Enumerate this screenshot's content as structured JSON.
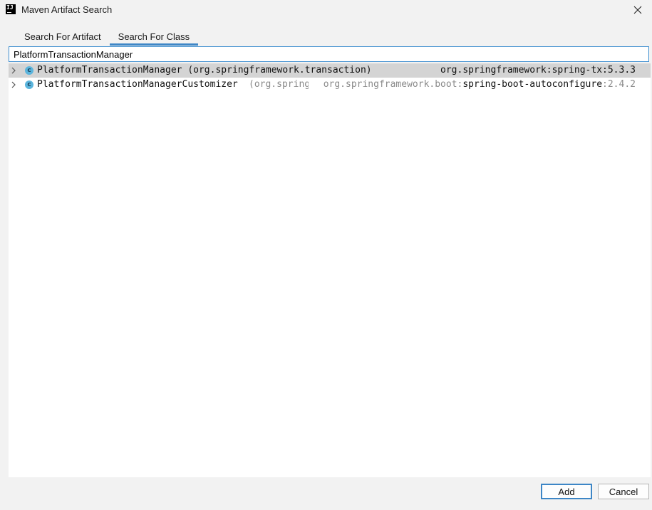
{
  "window": {
    "title": "Maven Artifact Search",
    "app_icon_text": "IJ",
    "app_icon": "intellij-icon",
    "close_icon": "close-icon"
  },
  "tabs": [
    {
      "label": "Search For Artifact",
      "active": false
    },
    {
      "label": "Search For Class",
      "active": true
    }
  ],
  "search": {
    "value": "PlatformTransactionManager",
    "placeholder": ""
  },
  "results": [
    {
      "icon": "class-icon",
      "icon_letter": "c",
      "class_name": "PlatformTransactionManager",
      "package": "(org.springframework.transaction)",
      "coord_group": "org.springframework:",
      "coord_artifact": "spring-tx",
      "coord_version": ":5.3.3",
      "selected": true
    },
    {
      "icon": "class-icon",
      "icon_letter": "c",
      "class_name": "PlatformTransactionManagerCustomizer",
      "package": "(org.spring",
      "coord_group": "org.springframework.boot:",
      "coord_artifact": "spring-boot-autoconfigure",
      "coord_version": ":2.4.2",
      "selected": false
    }
  ],
  "buttons": {
    "add_label": "Add",
    "cancel_label": "Cancel"
  },
  "colors": {
    "accent": "#3d86c6",
    "selection": "#d4d4d4",
    "class_icon": "#5bb5dd"
  }
}
